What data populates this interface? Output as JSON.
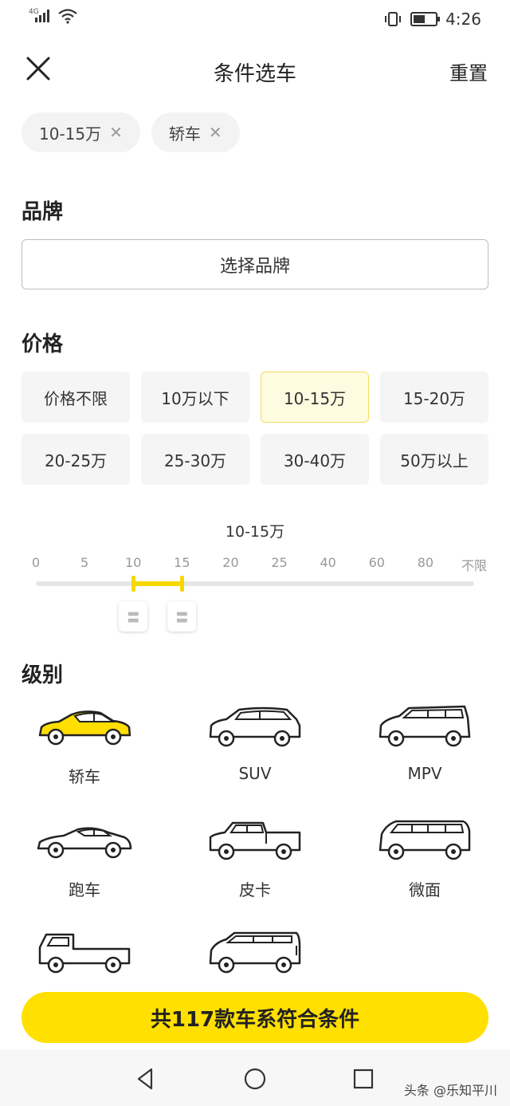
{
  "status_bar": {
    "network": "4G",
    "time": "4:26",
    "battery_level": 0.55
  },
  "header": {
    "title": "条件选车",
    "reset_label": "重置"
  },
  "filters": [
    {
      "label": "10-15万"
    },
    {
      "label": "轿车"
    }
  ],
  "brand": {
    "title": "品牌",
    "button_label": "选择品牌"
  },
  "price": {
    "title": "价格",
    "options": [
      "价格不限",
      "10万以下",
      "10-15万",
      "15-20万",
      "20-25万",
      "25-30万",
      "30-40万",
      "50万以上"
    ],
    "selected_index": 2,
    "range_label": "10-15万",
    "scale_ticks": [
      "0",
      "5",
      "10",
      "15",
      "20",
      "25",
      "40",
      "60",
      "80",
      "不限"
    ],
    "range_low_tick": 2,
    "range_high_tick": 3
  },
  "level": {
    "title": "级别",
    "items": [
      {
        "label": "轿车",
        "icon": "sedan-icon",
        "selected": true
      },
      {
        "label": "SUV",
        "icon": "suv-icon",
        "selected": false
      },
      {
        "label": "MPV",
        "icon": "mpv-icon",
        "selected": false
      },
      {
        "label": "跑车",
        "icon": "sports-car-icon",
        "selected": false
      },
      {
        "label": "皮卡",
        "icon": "pickup-icon",
        "selected": false
      },
      {
        "label": "微面",
        "icon": "minivan-icon",
        "selected": false
      },
      {
        "label": "",
        "icon": "light-truck-icon",
        "selected": false
      },
      {
        "label": "",
        "icon": "van-icon",
        "selected": false
      }
    ]
  },
  "cta": {
    "label": "共117款车系符合条件"
  },
  "watermark": "头条 @乐知平川",
  "colors": {
    "accent": "#ffe000",
    "selected_bg": "#fffbe0",
    "selected_border": "#f2dc5d"
  }
}
